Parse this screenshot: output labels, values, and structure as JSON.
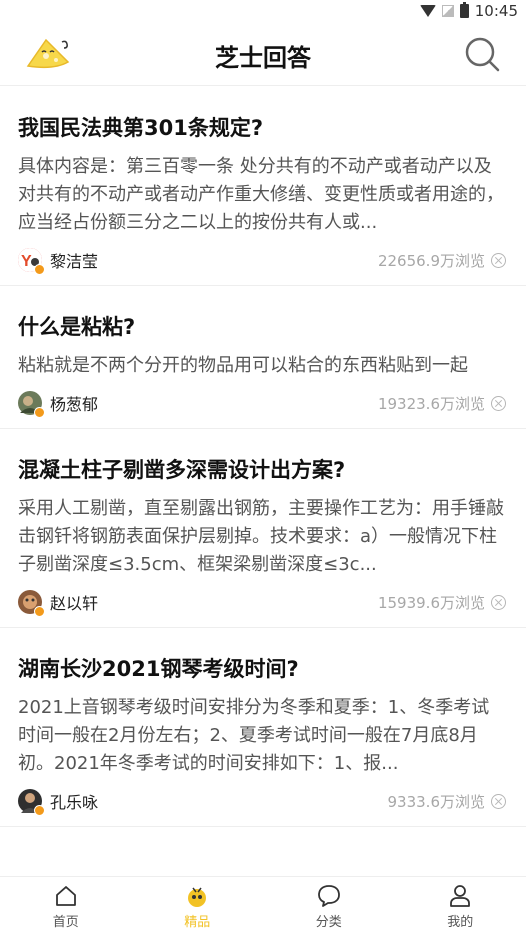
{
  "status_bar": {
    "time": "10:45"
  },
  "header": {
    "title": "芝士回答"
  },
  "questions": [
    {
      "title": "我国民法典第301条规定?",
      "excerpt": "具体内容是：第三百零一条 处分共有的不动产或者动产以及对共有的不动产或者动产作重大修缮、变更性质或者用途的，应当经占份额三分之二以上的按份共有人或...",
      "author": "黎洁莹",
      "views": "22656.9万浏览"
    },
    {
      "title": "什么是粘粘?",
      "excerpt": "粘粘就是不两个分开的物品用可以粘合的东西粘贴到一起",
      "author": "杨葱郁",
      "views": "19323.6万浏览"
    },
    {
      "title": "混凝土柱子剔凿多深需设计出方案?",
      "excerpt": "采用人工剔凿，直至剔露出钢筋，主要操作工艺为：用手锤敲击钢钎将钢筋表面保护层剔掉。技术要求：a）一般情况下柱子剔凿深度≤3.5cm、框架梁剔凿深度≤3c...",
      "author": "赵以轩",
      "views": "15939.6万浏览"
    },
    {
      "title": "湖南长沙2021钢琴考级时间?",
      "excerpt": "2021上音钢琴考级时间安排分为冬季和夏季：1、冬季考试时间一般在2月份左右；2、夏季考试时间一般在7月底8月初。2021年冬季考试的时间安排如下：1、报...",
      "author": "孔乐咏",
      "views": "9333.6万浏览"
    }
  ],
  "nav": {
    "home": "首页",
    "featured": "精品",
    "category": "分类",
    "mine": "我的"
  },
  "colors": {
    "accent": "#f2c225",
    "badge": "#f39a1b",
    "muted": "#a7a7a7"
  }
}
